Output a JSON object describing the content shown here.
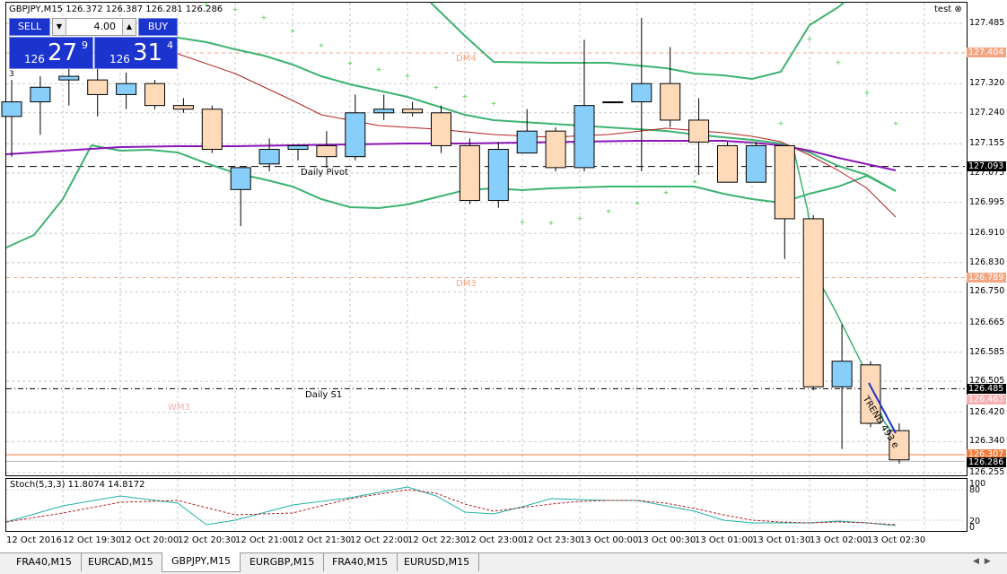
{
  "chart": {
    "title": "GBPJPY,M15  126.372 126.387 126.281 126.286",
    "account_label": "test",
    "panel_count": "3"
  },
  "one_click": {
    "sell_label": "SELL",
    "buy_label": "BUY",
    "lot": "4.00",
    "sell_small": "126",
    "sell_big": "27",
    "sell_sup": "9",
    "buy_small": "126",
    "buy_big": "31",
    "buy_sup": "4"
  },
  "price_axis": [
    "127.485",
    "127.320",
    "127.240",
    "127.155",
    "127.075",
    "126.995",
    "126.910",
    "126.830",
    "126.750",
    "126.665",
    "126.585",
    "126.505",
    "126.420",
    "126.340",
    "126.255"
  ],
  "price_tags": {
    "dm4": "127.404",
    "pivot": "127.093",
    "dm3": "126.789",
    "s1": "126.485",
    "wm3": "126.463",
    "orange": "126.307",
    "current": "126.286"
  },
  "labels": {
    "dm4": "DM4",
    "dm3": "DM3",
    "wm3": "WM3",
    "daily_pivot": "Daily Pivot",
    "daily_s1": "Daily S1",
    "trend": "TREND 493 e"
  },
  "stoch": {
    "title": "Stoch(5,3,3) 11.8074 14.8172",
    "scale": [
      "100",
      "80",
      "20",
      "0"
    ]
  },
  "time_axis": [
    "12 Oct 2016",
    "12 Oct 19:30",
    "12 Oct 20:00",
    "12 Oct 20:30",
    "12 Oct 21:00",
    "12 Oct 21:30",
    "12 Oct 22:00",
    "12 Oct 22:30",
    "12 Oct 23:00",
    "12 Oct 23:30",
    "13 Oct 00:00",
    "13 Oct 00:30",
    "13 Oct 01:00",
    "13 Oct 01:30",
    "13 Oct 02:00",
    "13 Oct 02:30"
  ],
  "tabs": [
    "FRA40,M15",
    "EURCAD,M15",
    "GBPJPY,M15",
    "EURGBP,M15",
    "FRA40,M15",
    "EURUSD,M15"
  ],
  "active_tab": "GBPJPY,M15",
  "colors": {
    "bull": "#87cefa",
    "bear": "#ffdab9",
    "bollinger": "#3cb371",
    "ma_red": "#b22222",
    "ma_purple": "#8b16b8",
    "stoch_main": "#20b2aa",
    "stoch_signal": "#b22222",
    "sar": "#32cd32",
    "pivot_orange": "#f4a582"
  },
  "chart_data": {
    "type": "candlestick",
    "symbol": "GBPJPY",
    "timeframe": "M15",
    "candles": [
      {
        "o": 127.23,
        "h": 127.33,
        "l": 127.12,
        "c": 127.27
      },
      {
        "o": 127.27,
        "h": 127.34,
        "l": 127.18,
        "c": 127.31
      },
      {
        "o": 127.33,
        "h": 127.36,
        "l": 127.26,
        "c": 127.34
      },
      {
        "o": 127.33,
        "h": 127.37,
        "l": 127.23,
        "c": 127.29
      },
      {
        "o": 127.29,
        "h": 127.35,
        "l": 127.25,
        "c": 127.32
      },
      {
        "o": 127.32,
        "h": 127.33,
        "l": 127.25,
        "c": 127.26
      },
      {
        "o": 127.26,
        "h": 127.28,
        "l": 127.24,
        "c": 127.25
      },
      {
        "o": 127.25,
        "h": 127.26,
        "l": 127.13,
        "c": 127.14
      },
      {
        "o": 127.03,
        "h": 127.09,
        "l": 126.93,
        "c": 127.09
      },
      {
        "o": 127.1,
        "h": 127.17,
        "l": 127.08,
        "c": 127.14
      },
      {
        "o": 127.14,
        "h": 127.15,
        "l": 127.11,
        "c": 127.15
      },
      {
        "o": 127.15,
        "h": 127.19,
        "l": 127.09,
        "c": 127.12
      },
      {
        "o": 127.12,
        "h": 127.29,
        "l": 127.11,
        "c": 127.24
      },
      {
        "o": 127.24,
        "h": 127.29,
        "l": 127.22,
        "c": 127.25
      },
      {
        "o": 127.25,
        "h": 127.27,
        "l": 127.23,
        "c": 127.24
      },
      {
        "o": 127.24,
        "h": 127.26,
        "l": 127.13,
        "c": 127.15
      },
      {
        "o": 127.15,
        "h": 127.17,
        "l": 126.99,
        "c": 127.0
      },
      {
        "o": 127.0,
        "h": 127.16,
        "l": 126.98,
        "c": 127.14
      },
      {
        "o": 127.13,
        "h": 127.25,
        "l": 127.13,
        "c": 127.19
      },
      {
        "o": 127.19,
        "h": 127.2,
        "l": 127.08,
        "c": 127.09
      },
      {
        "o": 127.09,
        "h": 127.44,
        "l": 127.08,
        "c": 127.26
      },
      {
        "o": 127.27,
        "h": 127.27,
        "l": 127.27,
        "c": 127.27
      },
      {
        "o": 127.27,
        "h": 127.5,
        "l": 127.08,
        "c": 127.32
      },
      {
        "o": 127.32,
        "h": 127.42,
        "l": 127.2,
        "c": 127.22
      },
      {
        "o": 127.22,
        "h": 127.28,
        "l": 127.07,
        "c": 127.16
      },
      {
        "o": 127.15,
        "h": 127.16,
        "l": 127.05,
        "c": 127.05
      },
      {
        "o": 127.05,
        "h": 127.16,
        "l": 127.05,
        "c": 127.15
      },
      {
        "o": 127.15,
        "h": 127.15,
        "l": 126.84,
        "c": 126.95
      },
      {
        "o": 126.95,
        "h": 126.96,
        "l": 126.48,
        "c": 126.49
      },
      {
        "o": 126.49,
        "h": 126.66,
        "l": 126.32,
        "c": 126.56
      },
      {
        "o": 126.55,
        "h": 126.56,
        "l": 126.38,
        "c": 126.39
      },
      {
        "o": 126.37,
        "h": 126.39,
        "l": 126.28,
        "c": 126.29
      }
    ],
    "levels": {
      "DM4": 127.404,
      "Daily Pivot": 127.093,
      "DM3": 126.789,
      "Daily S1": 126.485,
      "WM3": 126.463,
      "Last": 126.286
    },
    "ylim": [
      126.255,
      127.52
    ],
    "stochastic": {
      "k_period": 5,
      "d_period": 3,
      "slowing": 3,
      "main": 11.8074,
      "signal": 14.8172,
      "ylim": [
        0,
        100
      ]
    }
  }
}
